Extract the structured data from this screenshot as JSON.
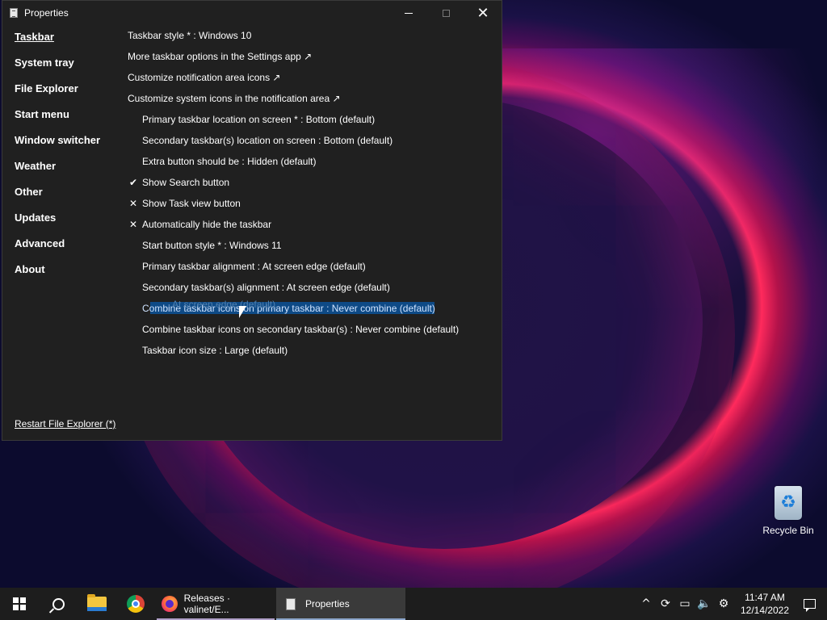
{
  "window": {
    "title": "Properties",
    "controls": {
      "minimize": "—",
      "maximize": "☐",
      "close": "✕"
    }
  },
  "sidebar": {
    "items": [
      {
        "label": "Taskbar",
        "active": true
      },
      {
        "label": "System tray"
      },
      {
        "label": "File Explorer"
      },
      {
        "label": "Start menu"
      },
      {
        "label": "Window switcher"
      },
      {
        "label": "Weather"
      },
      {
        "label": "Other"
      },
      {
        "label": "Updates"
      },
      {
        "label": "Advanced"
      },
      {
        "label": "About"
      }
    ],
    "restart_link": "Restart File Explorer (*)"
  },
  "settings": {
    "rows": [
      {
        "text": "Taskbar style * : Windows 10",
        "indent": false,
        "mark": ""
      },
      {
        "text": "More taskbar options in the Settings app ↗",
        "indent": false,
        "mark": ""
      },
      {
        "text": "Customize notification area icons ↗",
        "indent": false,
        "mark": ""
      },
      {
        "text": "Customize system icons in the notification area ↗",
        "indent": false,
        "mark": ""
      },
      {
        "text": "Primary taskbar location on screen * : Bottom (default)",
        "indent": true,
        "mark": ""
      },
      {
        "text": "Secondary taskbar(s) location on screen : Bottom (default)",
        "indent": true,
        "mark": ""
      },
      {
        "text": "Extra button should be : Hidden (default)",
        "indent": true,
        "mark": ""
      },
      {
        "text": "Show Search button",
        "indent": true,
        "mark": "✔"
      },
      {
        "text": "Show Task view button",
        "indent": true,
        "mark": "✕"
      },
      {
        "text": "Automatically hide the taskbar",
        "indent": true,
        "mark": "✕"
      },
      {
        "text": "Start button style * : Windows 11",
        "indent": true,
        "mark": ""
      },
      {
        "text": "Primary taskbar alignment : At screen edge (default)",
        "indent": true,
        "mark": ""
      },
      {
        "text": "Secondary taskbar(s) alignment : At screen edge (default)",
        "indent": true,
        "mark": ""
      },
      {
        "text": "Combine taskbar icons on primary taskbar : Never combine (default)",
        "indent": true,
        "mark": "",
        "highlight": true,
        "ghost": "At screen edge (default)"
      },
      {
        "text": "Combine taskbar icons on secondary taskbar(s) : Never combine (default)",
        "indent": true,
        "mark": ""
      },
      {
        "text": "Taskbar icon size : Large (default)",
        "indent": true,
        "mark": ""
      }
    ]
  },
  "desktop": {
    "recycle_bin_label": "Recycle Bin"
  },
  "taskbar": {
    "start_icon": "windows-logo-icon",
    "search_icon": "search-icon",
    "pinned": [
      "file-explorer-icon",
      "chrome-icon"
    ],
    "tasks": [
      {
        "label": "Releases · valinet/E...",
        "icon": "firefox-icon"
      },
      {
        "label": "Properties",
        "icon": "properties-icon",
        "active": true
      }
    ],
    "tray": {
      "chevron": "^",
      "sync": "⟳",
      "network": "▭",
      "volume": "🔈",
      "settings": "⚙"
    },
    "clock": {
      "time": "11:47 AM",
      "date": "12/14/2022"
    }
  },
  "colors": {
    "window_bg": "#202020",
    "taskbar_bg": "#1d1d1d",
    "highlight": "#0e4a86",
    "active_task_bg": "#3a3a3a"
  }
}
